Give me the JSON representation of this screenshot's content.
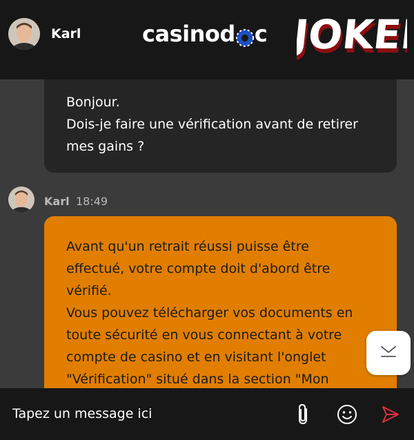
{
  "header": {
    "agent_name": "Karl",
    "logo_casino_prefix": "casinod",
    "logo_casino_suffix": "c",
    "logo_jokery": "JOKERY"
  },
  "conversation": {
    "user_message_lines": [
      "Bonjour.",
      "Dois-je faire une vérification avant de retirer",
      "mes gains ?"
    ],
    "agent_name": "Karl",
    "agent_time": "18:49",
    "agent_message_lines": [
      "Avant qu'un retrait réussi puisse être",
      "effectué, votre compte doit d'abord être",
      "vérifié.",
      "Vous pouvez télécharger vos documents en",
      "toute sécurité en vous connectant à votre",
      "compte de casino et en visitant l'onglet",
      "\"Vérification\" situé dans la section \"Mon"
    ]
  },
  "composer": {
    "placeholder": "Tapez un message ici",
    "icons": [
      "paperclip-icon",
      "smiley-icon",
      "send-icon"
    ]
  },
  "colors": {
    "header_bg": "#171717",
    "chat_bg": "#3b3b3b",
    "user_bubble": "#252525",
    "agent_bubble": "#e17e00",
    "send_accent": "#e0303c"
  }
}
